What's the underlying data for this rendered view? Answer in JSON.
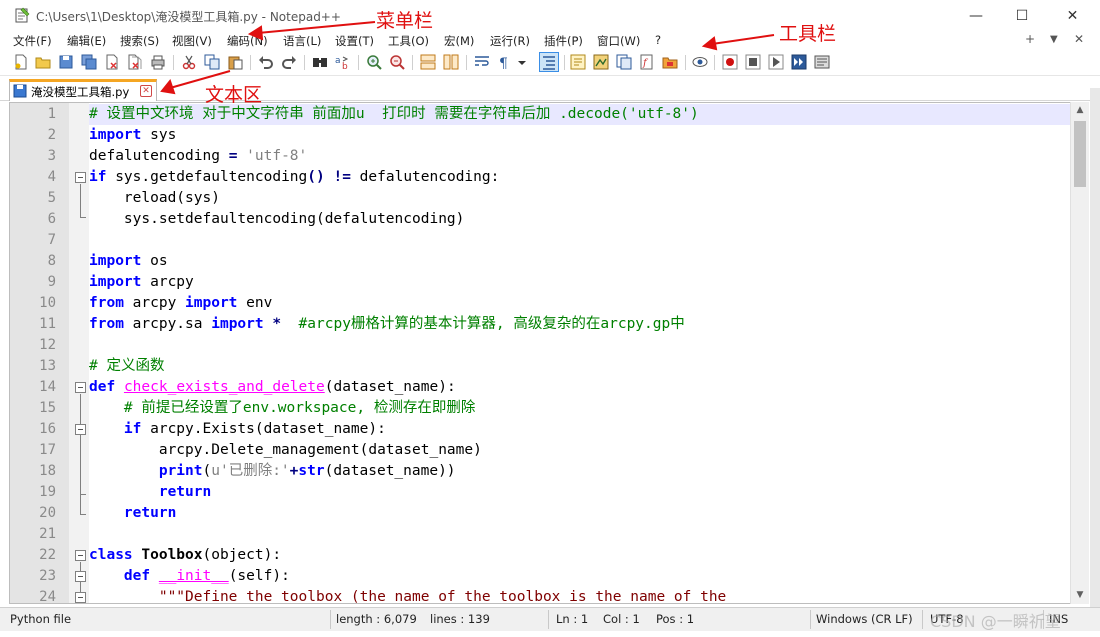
{
  "window": {
    "title": "C:\\Users\\1\\Desktop\\淹没模型工具箱.py - Notepad++",
    "minimize_glyph": "—",
    "maximize_glyph": "☐",
    "close_glyph": "✕"
  },
  "menu": {
    "items": [
      {
        "label": "文件(F)"
      },
      {
        "label": "编辑(E)"
      },
      {
        "label": "搜索(S)"
      },
      {
        "label": "视图(V)"
      },
      {
        "label": "编码(N)"
      },
      {
        "label": "语言(L)"
      },
      {
        "label": "设置(T)"
      },
      {
        "label": "工具(O)"
      },
      {
        "label": "宏(M)"
      },
      {
        "label": "运行(R)"
      },
      {
        "label": "插件(P)"
      },
      {
        "label": "窗口(W)"
      },
      {
        "label": "?"
      }
    ],
    "right_controls": {
      "add": "+",
      "dropdown": "▼",
      "close": "✕"
    }
  },
  "toolbar": {
    "icons": [
      "new-file-icon",
      "open-file-icon",
      "save-icon",
      "save-all-icon",
      "close-icon",
      "close-all-icon",
      "print-icon",
      "cut-icon",
      "copy-icon",
      "paste-icon",
      "undo-icon",
      "redo-icon",
      "find-icon",
      "replace-icon",
      "zoom-in-icon",
      "zoom-out-icon",
      "sync-vertical-icon",
      "sync-horizontal-icon",
      "word-wrap-icon",
      "show-all-chars-icon",
      "indent-guide-icon",
      "udl-icon",
      "doc-map-icon",
      "function-list-icon",
      "folder-workspace-icon",
      "monitor-icon",
      "record-macro-icon",
      "stop-macro-icon",
      "play-macro-icon",
      "run-macro-multiple-icon",
      "save-macro-icon"
    ]
  },
  "tab": {
    "label": "淹没模型工具箱.py",
    "close_glyph": "✕"
  },
  "editor": {
    "lines": [
      {
        "n": "1"
      },
      {
        "n": "2"
      },
      {
        "n": "3"
      },
      {
        "n": "4"
      },
      {
        "n": "5"
      },
      {
        "n": "6"
      },
      {
        "n": "7"
      },
      {
        "n": "8"
      },
      {
        "n": "9"
      },
      {
        "n": "10"
      },
      {
        "n": "11"
      },
      {
        "n": "12"
      },
      {
        "n": "13"
      },
      {
        "n": "14"
      },
      {
        "n": "15"
      },
      {
        "n": "16"
      },
      {
        "n": "17"
      },
      {
        "n": "18"
      },
      {
        "n": "19"
      },
      {
        "n": "20"
      },
      {
        "n": "21"
      },
      {
        "n": "22"
      },
      {
        "n": "23"
      },
      {
        "n": "24"
      }
    ],
    "code": {
      "l1": "# 设置中文环境 对于中文字符串 前面加u  打印时 需要在字符串后加 .decode('utf-8')",
      "l2_kw": "import",
      "l2_rest": " sys",
      "l3_a": "defalutencoding ",
      "l3_op": "=",
      "l3_sp": " ",
      "l3_str": "'utf-8'",
      "l4_kw": "if",
      "l4_a": " sys.getdefaultencoding",
      "l4_op1": "()",
      "l4_sp": " ",
      "l4_op2": "!=",
      "l4_b": " defalutencoding:",
      "l5": "    reload(sys)",
      "l6": "    sys.setdefaultencoding(defalutencoding)",
      "l8_kw": "import",
      "l8_rest": " os",
      "l9_kw": "import",
      "l9_rest": " arcpy",
      "l10_kw1": "from",
      "l10_a": " arcpy ",
      "l10_kw2": "import",
      "l10_b": " env",
      "l11_kw1": "from",
      "l11_a": " arcpy.sa ",
      "l11_kw2": "import",
      "l11_op": " *",
      "l11_cmt": "  #arcpy栅格计算的基本计算器, 高级复杂的在arcpy.gp中",
      "l13": "# 定义函数",
      "l14_kw": "def",
      "l14_sp": " ",
      "l14_fn": "check_exists_and_delete",
      "l14_rest": "(dataset_name):",
      "l15_ind": "    ",
      "l15_cmt": "# 前提已经设置了env.workspace, 检测存在即删除",
      "l16_ind": "    ",
      "l16_kw": "if",
      "l16_rest": " arcpy.Exists(dataset_name):",
      "l17": "        arcpy.Delete_management(dataset_name)",
      "l18_ind": "        ",
      "l18_kw": "print",
      "l18_a": "(",
      "l18_str": "u'已删除:'",
      "l18_op": "+",
      "l18_kw2": "str",
      "l18_b": "(dataset_name))",
      "l19_ind": "        ",
      "l19_kw": "return",
      "l20_ind": "    ",
      "l20_kw": "return",
      "l22_kw": "class",
      "l22_sp": " ",
      "l22_cls": "Toolbox",
      "l22_rest": "(object):",
      "l23_ind": "    ",
      "l23_kw": "def",
      "l23_sp": " ",
      "l23_fn": "__init__",
      "l23_rest": "(self):",
      "l24_ind": "        ",
      "l24_str": "\"\"\"Define the toolbox (the name of the toolbox is the name of the"
    }
  },
  "statusbar": {
    "file_type": "Python file",
    "length": "length : 6,079",
    "lines": "lines : 139",
    "ln": "Ln : 1",
    "col": "Col : 1",
    "pos": "Pos : 1",
    "eol": "Windows (CR LF)",
    "encoding": "UTF-8",
    "mode": "INS"
  },
  "annotations": {
    "menu": "菜单栏",
    "toolbar": "工具栏",
    "text_area": "文本区"
  },
  "watermark": "CSDN @一瞬祈望"
}
